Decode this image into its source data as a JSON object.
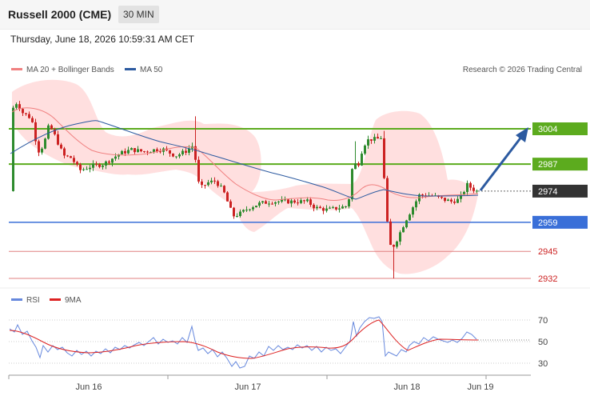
{
  "header": {
    "title": "Russell 2000 (CME)",
    "interval": "30 MIN",
    "timestamp": "Thursday, June 18, 2026 10:59:31 AM CET"
  },
  "legend": {
    "ma20": "MA 20 + Bollinger Bands",
    "ma50": "MA 50",
    "credit": "Research © 2026 Trading Central",
    "rsi": "RSI",
    "rsi_ma": "9MA"
  },
  "colors": {
    "bull": "#2e8b2e",
    "bear": "#cc2222",
    "ma20": "#f08080",
    "ma50": "#2c5aa0",
    "band_fill": "#ffd9d9",
    "resistance": "#5cab1e",
    "support": "#3a6fd8",
    "pivot_dark": "#333333",
    "arrow": "#2c5aa0",
    "rsi_line": "#6688dd",
    "rsi_ma_line": "#dd2222"
  },
  "chart_data": [
    {
      "type": "candlestick",
      "title": "Russell 2000 (CME)",
      "interval": "30 MIN",
      "ylim": [
        2928,
        3025
      ],
      "x_labels": [
        "Jun 16",
        "Jun 17",
        "Jun 18",
        "Jun 19"
      ],
      "levels": [
        {
          "value": 3004,
          "label": "3004",
          "kind": "resistance"
        },
        {
          "value": 2987,
          "label": "2987",
          "kind": "resistance"
        },
        {
          "value": 2974,
          "label": "2974",
          "kind": "current"
        },
        {
          "value": 2959,
          "label": "2959",
          "kind": "support"
        },
        {
          "value": 2945,
          "label": "2945",
          "kind": "minor"
        },
        {
          "value": 2932,
          "label": "2932",
          "kind": "minor"
        }
      ],
      "target_arrow": {
        "from": 2974,
        "to": 3004
      },
      "series": [
        {
          "name": "MA 20 + Bollinger Bands"
        },
        {
          "name": "MA 50"
        }
      ]
    },
    {
      "type": "line",
      "title": "RSI",
      "ylim": [
        25,
        80
      ],
      "y_ticks": [
        70,
        50,
        30
      ],
      "series": [
        {
          "name": "RSI"
        },
        {
          "name": "9MA"
        }
      ]
    }
  ]
}
